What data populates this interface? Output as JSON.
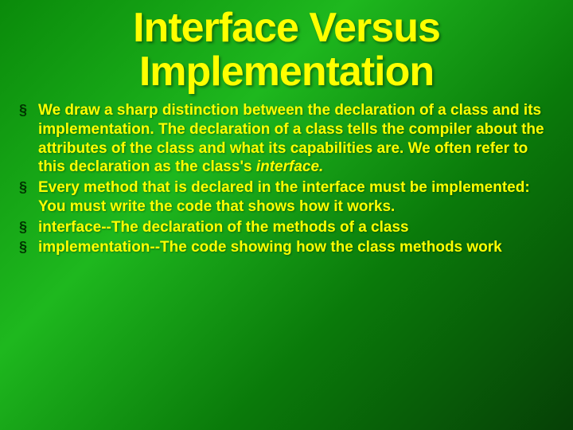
{
  "title": "Interface Versus Implementation",
  "bullets": [
    {
      "pre": "We draw a sharp distinction between the declaration of a class and its implementation. The declaration of a class tells the compiler about the attributes of the class and what its capabilities are. We often refer to this declaration as the class's ",
      "italic": "interface.",
      "post": ""
    },
    {
      "pre": "Every method that is declared in the interface must be implemented: You must write the code that shows how it works.",
      "italic": "",
      "post": ""
    },
    {
      "pre": "interface--The declaration of the methods of a class",
      "italic": "",
      "post": ""
    },
    {
      "pre": "implementation--The code showing how the class methods work",
      "italic": "",
      "post": ""
    }
  ],
  "bullet_glyph": "§"
}
